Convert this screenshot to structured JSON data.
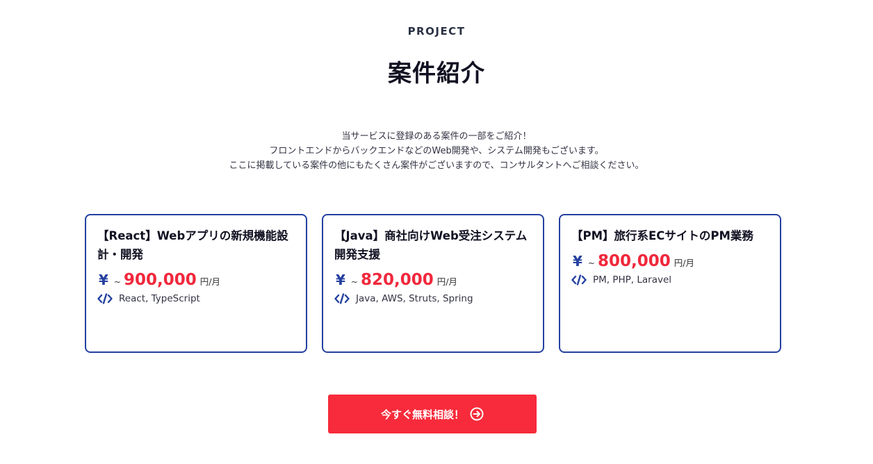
{
  "section": {
    "eyebrow": "PROJECT",
    "title": "案件紹介",
    "lead": [
      "当サービスに登録のある案件の一部をご紹介！",
      "フロントエンドからバックエンドなどのWeb開発や、システム開発もございます。",
      "ここに掲載している案件の他にもたくさん案件がございますので、コンサルタントへご相談ください。"
    ]
  },
  "cards": [
    {
      "title": "【React】Webアプリの新規機能設計・開発",
      "yen": "¥",
      "tilde": "~",
      "amount": "900,000",
      "unit": "円/月",
      "tech": "React, TypeScript",
      "icon": "code-icon"
    },
    {
      "title": "【Java】商社向けWeb受注システム開発支援",
      "yen": "¥",
      "tilde": "~",
      "amount": "820,000",
      "unit": "円/月",
      "tech": "Java, AWS, Struts, Spring",
      "icon": "code-icon"
    },
    {
      "title": "【PM】旅行系ECサイトのPM業務",
      "yen": "¥",
      "tilde": "~",
      "amount": "800,000",
      "unit": "円/月",
      "tech": "PM, PHP, Laravel",
      "icon": "code-icon"
    }
  ],
  "cta": {
    "label": "今すぐ無料相談！",
    "icon": "arrow-circle-right-icon"
  },
  "colors": {
    "accent_blue": "#2440a0",
    "accent_red": "#f72b3b",
    "price_red": "#f0283c"
  }
}
